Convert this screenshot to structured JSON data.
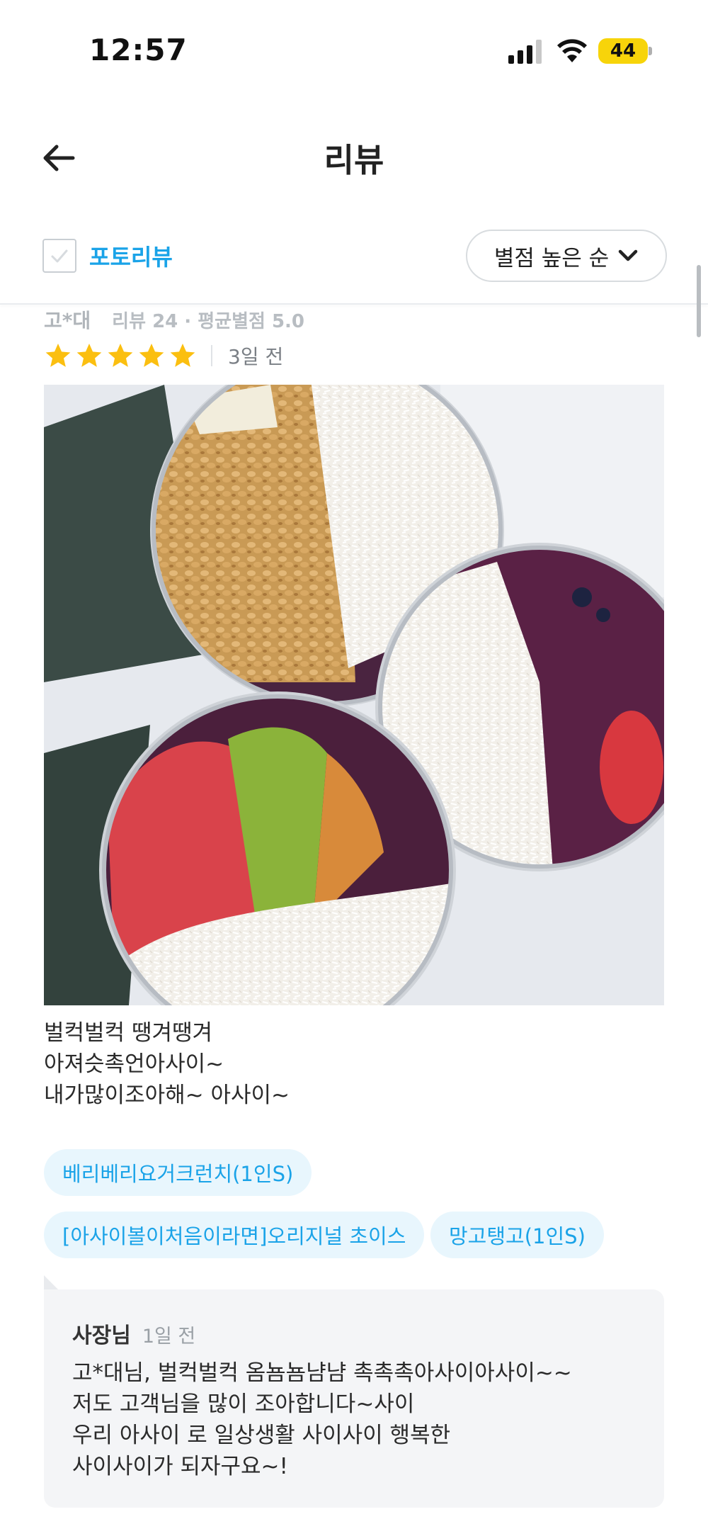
{
  "status_bar": {
    "time": "12:57",
    "battery": "44"
  },
  "header": {
    "title": "리뷰"
  },
  "filters": {
    "photo_review_label": "포토리뷰",
    "sort_label": "별점 높은 순"
  },
  "review": {
    "reviewer_name": "고*대",
    "reviewer_meta": "리뷰 24 · 평균별점 5.0",
    "rating": 5,
    "date": "3일 전",
    "text_lines": [
      "벌컥벌컥 땡겨땡겨",
      "아져슷촉언아사이~",
      "내가많이조아해~ 아사이~"
    ],
    "menu_items": [
      "베리베리요거크런치(1인S)",
      "[아사이볼이처음이라면]오리지널 초이스",
      "망고탱고(1인S)"
    ]
  },
  "owner_reply": {
    "author": "사장님",
    "date": "1일 전",
    "lines": [
      "고*대님, 벌컥벌컥 옴뇸뇸냠냠 촉촉촉아사이아사이~~",
      "저도 고객님을 많이 조아합니다~사이",
      "우리 아사이 로 일상생활 사이사이 행복한",
      "사이사이가 되자구요~!"
    ]
  },
  "colors": {
    "accent": "#1aa3e8",
    "star": "#fbbf10",
    "chip_bg": "#e8f6fd",
    "reply_bg": "#f4f5f7"
  },
  "icons": [
    "back-arrow-icon",
    "checkbox-icon",
    "chevron-down-icon",
    "star-icon",
    "cellular-signal-icon",
    "wifi-icon",
    "battery-icon"
  ]
}
